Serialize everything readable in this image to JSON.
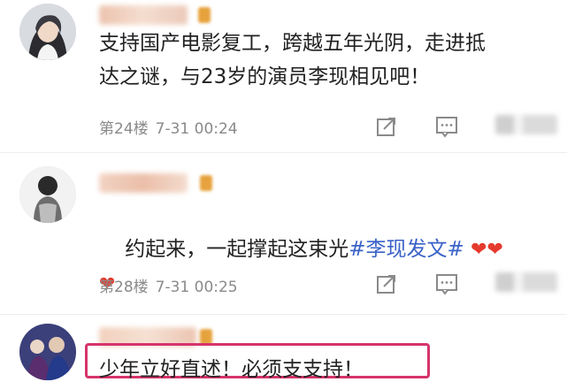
{
  "comments": [
    {
      "content": "支持国产电影复工，跨越五年光阴，走进抵\n达之谜，与23岁的演员李现相见吧！",
      "floor": "第24楼",
      "time": "7-31 00:24"
    },
    {
      "content_prefix": "约起来，一起撑起这束光",
      "topic": "#李现发文#",
      "hearts_line1": "❤❤",
      "hearts_line2": "❤",
      "floor": "第28楼",
      "time": "7-31 00:25"
    },
    {
      "content": "少年立好直述！必须支支持！"
    }
  ],
  "icons": {
    "share": "share-icon",
    "comment": "comment-icon",
    "like": "thumbs-up-icon",
    "badge": "vip-badge-icon"
  },
  "colors": {
    "topic": "#3a62c8",
    "heart": "#e53b2e",
    "highlight": "#d6336c",
    "meta": "#8a8a8a"
  }
}
